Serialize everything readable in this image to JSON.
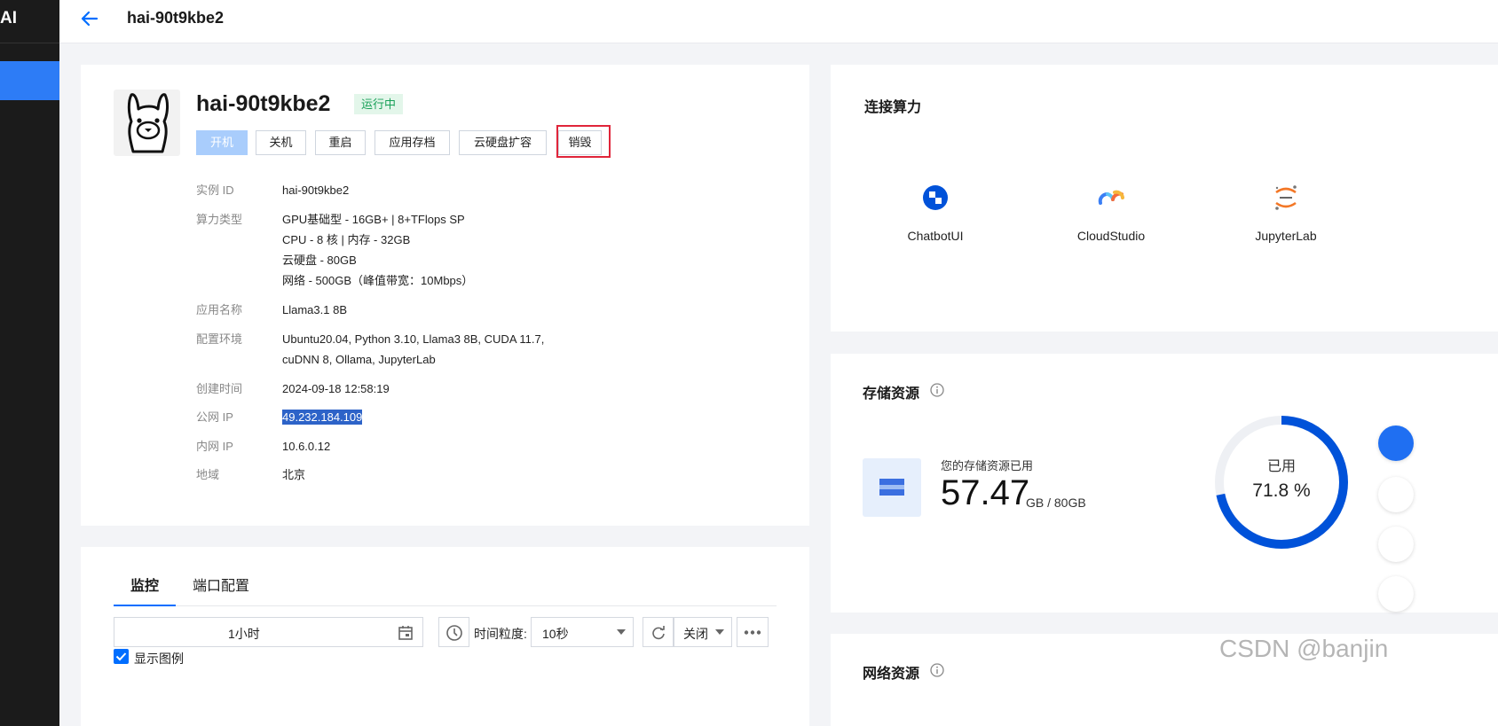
{
  "app": {
    "brand": "AI"
  },
  "header": {
    "title": "hai-90t9kbe2"
  },
  "instance": {
    "name": "hai-90t9kbe2",
    "status": "运行中",
    "buttons": {
      "start": "开机",
      "shutdown": "关机",
      "restart": "重启",
      "app_archive": "应用存档",
      "disk_expand": "云硬盘扩容",
      "destroy": "销毁"
    },
    "details": {
      "id_label": "实例 ID",
      "id_value": "hai-90t9kbe2",
      "compute_label": "算力类型",
      "compute_line1": "GPU基础型 - 16GB+ | 8+TFlops SP",
      "compute_line2": "CPU - 8 核 | 内存 - 32GB",
      "compute_line3": "云硬盘 - 80GB",
      "compute_line4": "网络 - 500GB（峰值带宽：10Mbps）",
      "app_label": "应用名称",
      "app_value": "Llama3.1 8B",
      "env_label": "配置环境",
      "env_line1": "Ubuntu20.04, Python 3.10, Llama3 8B, CUDA 11.7,",
      "env_line2": "cuDNN 8, Ollama, JupyterLab",
      "created_label": "创建时间",
      "created_value": "2024-09-18 12:58:19",
      "public_ip_label": "公网 IP",
      "public_ip_value": "49.232.184.109",
      "private_ip_label": "内网 IP",
      "private_ip_value": "10.6.0.12",
      "region_label": "地域",
      "region_value": "北京"
    }
  },
  "monitor": {
    "tabs": {
      "monitor": "监控",
      "ports": "端口配置"
    },
    "time_range": "1小时",
    "granularity_label": "时间粒度:",
    "granularity_value": "10秒",
    "refresh_value": "关闭",
    "legend_label": "显示图例"
  },
  "connect": {
    "title": "连接算力",
    "items": {
      "chatbot": "ChatbotUI",
      "cloudstudio": "CloudStudio",
      "jupyter": "JupyterLab"
    }
  },
  "storage": {
    "title": "存储资源",
    "caption": "您的存储资源已用",
    "used_value": "57.47",
    "unit": "GB / 80GB",
    "donut_label": "已用",
    "donut_percent": "71.8 %",
    "used_fraction": 0.718,
    "accent_color": "#0052d9"
  },
  "network": {
    "title": "网络资源"
  },
  "watermark": "CSDN @banjin",
  "colors": {
    "accent": "#006eff",
    "sidebar_active": "#2d7cf6",
    "status_bg": "#e3f6ea",
    "status_text": "#18a058",
    "highlight_border": "#e0253a"
  }
}
